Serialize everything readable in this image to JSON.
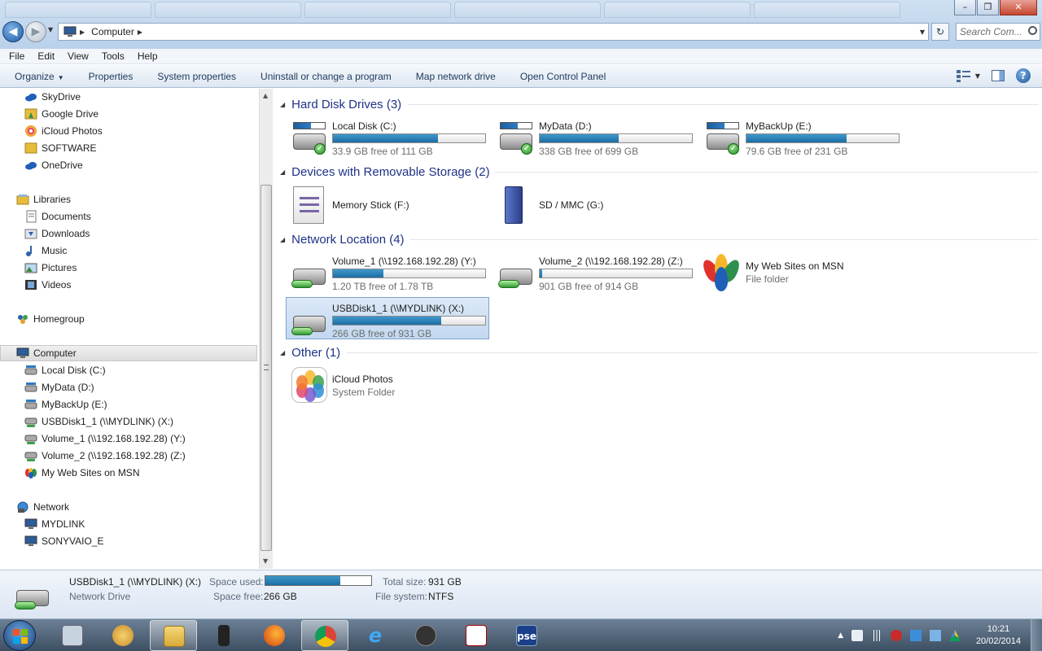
{
  "window": {
    "address_crumb": "Computer",
    "search_placeholder": "Search Com...",
    "minimize": "–",
    "maximize": "❐",
    "close": "✕"
  },
  "menu": [
    "File",
    "Edit",
    "View",
    "Tools",
    "Help"
  ],
  "commands": {
    "organize": "Organize",
    "properties": "Properties",
    "system_properties": "System properties",
    "uninstall": "Uninstall or change a program",
    "map_drive": "Map network drive",
    "control_panel": "Open Control Panel"
  },
  "nav": {
    "favorites": [
      "SkyDrive",
      "Google Drive",
      "iCloud Photos",
      "SOFTWARE",
      "OneDrive"
    ],
    "libraries_label": "Libraries",
    "libraries": [
      "Documents",
      "Downloads",
      "Music",
      "Pictures",
      "Videos"
    ],
    "homegroup": "Homegroup",
    "computer_label": "Computer",
    "computer_items": [
      "Local Disk (C:)",
      "MyData (D:)",
      "MyBackUp (E:)",
      "USBDisk1_1 (\\\\MYDLINK) (X:)",
      "Volume_1 (\\\\192.168.192.28) (Y:)",
      "Volume_2 (\\\\192.168.192.28) (Z:)",
      "My Web Sites on MSN"
    ],
    "network_label": "Network",
    "network_items": [
      "MYDLINK",
      "SONYVAIO_E"
    ]
  },
  "groups": {
    "hdd": "Hard Disk Drives (3)",
    "removable": "Devices with Removable Storage (2)",
    "network": "Network Location (4)",
    "other": "Other (1)"
  },
  "drives": {
    "c": {
      "name": "Local Disk (C:)",
      "free": "33.9 GB free of 111 GB",
      "used_fraction": 0.69
    },
    "d": {
      "name": "MyData (D:)",
      "free": "338 GB free of 699 GB",
      "used_fraction": 0.52
    },
    "e": {
      "name": "MyBackUp (E:)",
      "free": "79.6 GB free of 231 GB",
      "used_fraction": 0.66
    }
  },
  "removable": {
    "f": {
      "name": "Memory Stick (F:)"
    },
    "g": {
      "name": "SD / MMC (G:)"
    }
  },
  "network_locations": {
    "y": {
      "name": "Volume_1 (\\\\192.168.192.28) (Y:)",
      "free": "1.20 TB free of 1.78 TB",
      "used_fraction": 0.33
    },
    "z": {
      "name": "Volume_2 (\\\\192.168.192.28) (Z:)",
      "free": "901 GB free of 914 GB",
      "used_fraction": 0.015
    },
    "msn": {
      "name": "My Web Sites on MSN",
      "type": "File folder"
    },
    "x": {
      "name": "USBDisk1_1 (\\\\MYDLINK) (X:)",
      "free": "266 GB free of 931 GB",
      "used_fraction": 0.71
    }
  },
  "other": {
    "icloud": {
      "name": "iCloud Photos",
      "type": "System Folder"
    }
  },
  "details": {
    "name": "USBDisk1_1 (\\\\MYDLINK) (X:)",
    "type": "Network Drive",
    "space_used_label": "Space used:",
    "space_used_fraction": 0.71,
    "space_free_label": "Space free:",
    "space_free": "266 GB",
    "total_size_label": "Total size:",
    "total_size": "931 GB",
    "file_system_label": "File system:",
    "file_system": "NTFS"
  },
  "taskbar": {
    "time": "10:21",
    "date": "20/02/2014",
    "pse_label": "pse"
  },
  "colors": {
    "accent": "#1c6ea4",
    "group_header": "#1e3287"
  }
}
